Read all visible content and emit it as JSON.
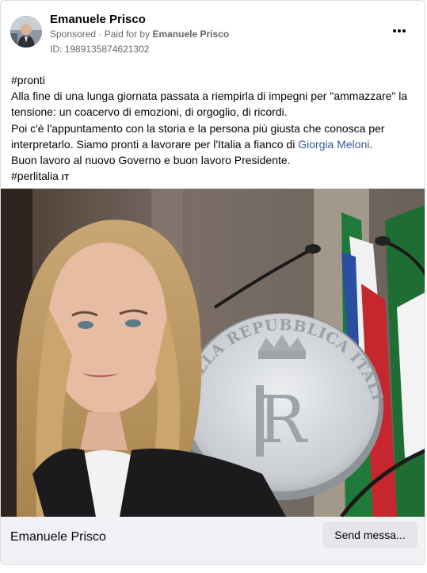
{
  "post": {
    "author": "Emanuele Prisco",
    "sponsored": "Sponsored",
    "paid_prefix": "Paid for by",
    "paid_by": "Emanuele Prisco",
    "ad_id": "ID: 1989135874621302",
    "text": {
      "line1": "#pronti",
      "line2": "Alla fine di una lunga giornata passata a riempirla di impegni per \"ammazzare\" la tensione: un coacervo di emozioni, di orgoglio, di ricordi.",
      "line3_pre": "Poi c'è l'appuntamento con la storia e la persona più giusta che conosca per interpretarlo. Siamo pronti a lavorare per l'Italia a fianco di ",
      "line3_mention": "Giorgia Meloni",
      "line3_post": ".",
      "line4": "Buon lavoro al nuovo Governo e buon lavoro Presidente.",
      "line5": "#perlitalia",
      "line5_flag": "IT"
    },
    "image": {
      "seal_text": "DELLA REPUBBLICA ITALIANA"
    }
  },
  "footer": {
    "name": "Emanuele Prisco",
    "button": "Send messa..."
  },
  "colors": {
    "link": "#385898",
    "muted": "#65676b",
    "footer_bg": "#f0f2f5",
    "button_bg": "#e4e6eb"
  }
}
